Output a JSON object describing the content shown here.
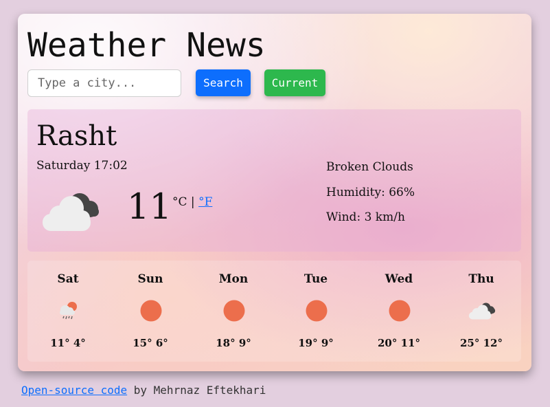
{
  "app": {
    "title": "Weather News"
  },
  "search": {
    "placeholder": "Type a city...",
    "value": "",
    "search_label": "Search",
    "current_label": "Current"
  },
  "today": {
    "city": "Rasht",
    "datetime": "Saturday 17:02",
    "temperature": "11",
    "unit_c": "°C",
    "separator": "|",
    "unit_f": "°F",
    "icon": "broken-clouds-icon",
    "description": "Broken Clouds",
    "humidity": "Humidity: 66%",
    "wind": "Wind: 3 km/h"
  },
  "forecast": [
    {
      "day": "Sat",
      "temps": "11° 4°",
      "icon": "rain-sun-icon"
    },
    {
      "day": "Sun",
      "temps": "15° 6°",
      "icon": "sun-icon"
    },
    {
      "day": "Mon",
      "temps": "18° 9°",
      "icon": "sun-icon"
    },
    {
      "day": "Tue",
      "temps": "19° 9°",
      "icon": "sun-icon"
    },
    {
      "day": "Wed",
      "temps": "20° 11°",
      "icon": "sun-icon"
    },
    {
      "day": "Thu",
      "temps": "25° 12°",
      "icon": "broken-clouds-icon"
    }
  ],
  "footer": {
    "link_text": "Open-source code",
    "by_text": "by Mehrnaz Eftekhari"
  },
  "colors": {
    "search_button": "#0d6efd",
    "current_button": "#2db84d",
    "sun": "#ec6e4c",
    "link": "#0d6efd"
  }
}
